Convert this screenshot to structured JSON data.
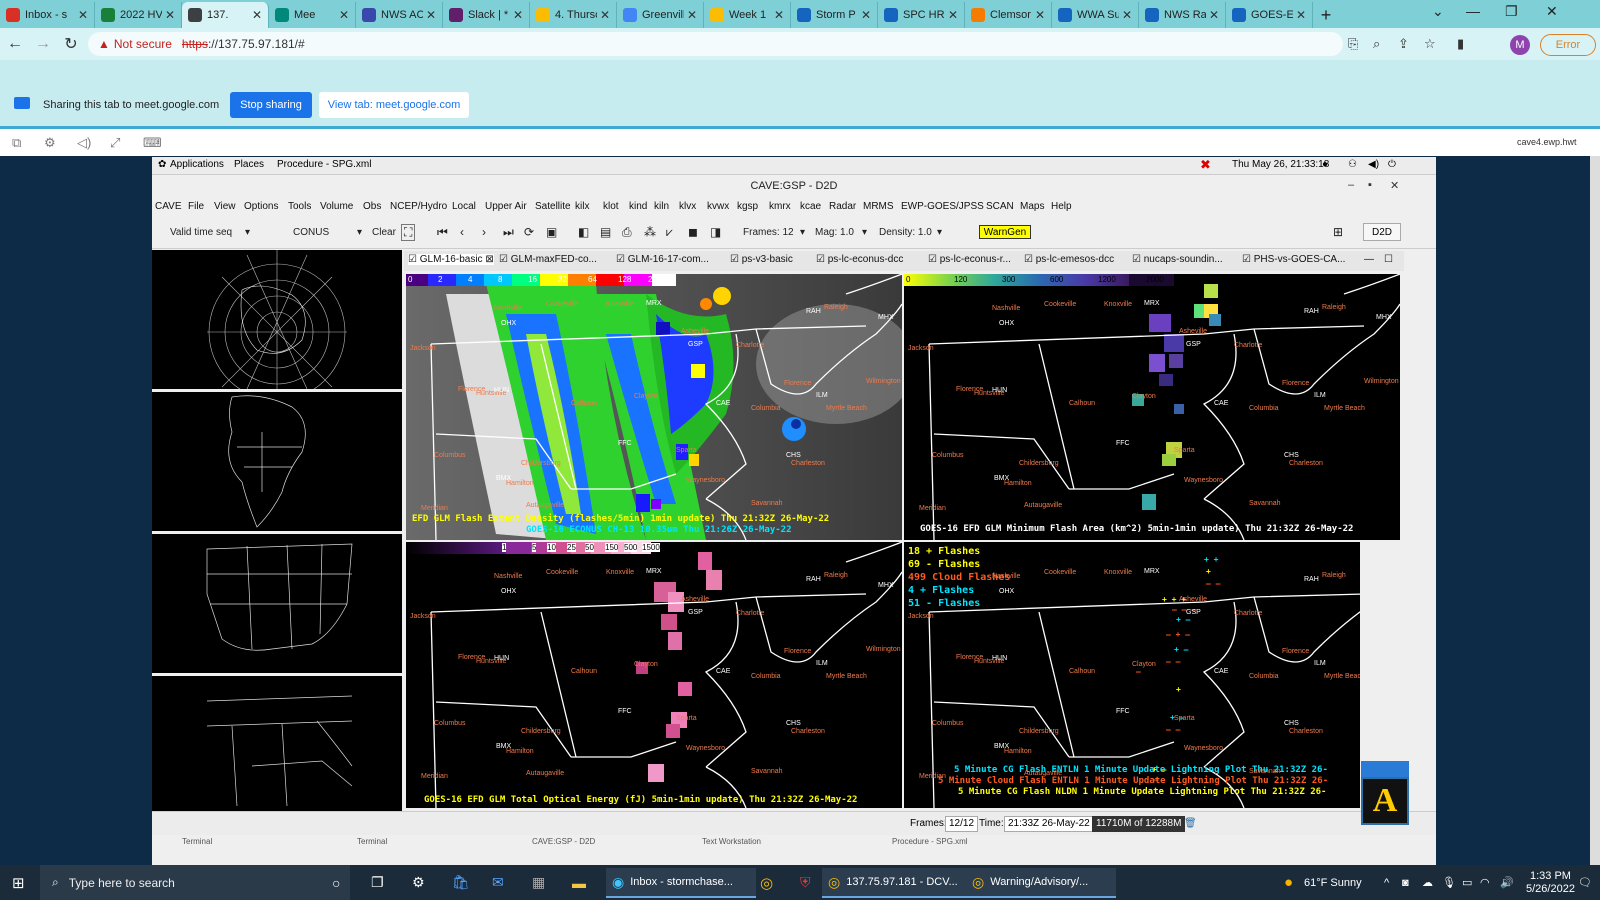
{
  "browser": {
    "tabs": [
      {
        "label": "Inbox - s",
        "color": "#d93025"
      },
      {
        "label": "2022 HV",
        "color": "#188038"
      },
      {
        "label": "137.",
        "color": "#3c4043",
        "active": true
      },
      {
        "label": "Mee",
        "color": "#00897b"
      },
      {
        "label": "NWS AC",
        "color": "#3949ab"
      },
      {
        "label": "Slack | *",
        "color": "#611f69"
      },
      {
        "label": "4. Thursc",
        "color": "#fbbc04"
      },
      {
        "label": "Greenvill",
        "color": "#4285f4"
      },
      {
        "label": "Week 1",
        "color": "#fbbc04"
      },
      {
        "label": "Storm P",
        "color": "#1565c0"
      },
      {
        "label": "SPC HRI",
        "color": "#1565c0"
      },
      {
        "label": "Clemsor",
        "color": "#f57c00"
      },
      {
        "label": "WWA Su",
        "color": "#1565c0"
      },
      {
        "label": "NWS Ra",
        "color": "#1565c0"
      },
      {
        "label": "GOES-E",
        "color": "#1565c0"
      }
    ],
    "new_tab": "+",
    "not_secure": "Not secure",
    "url_scheme": "https",
    "url_rest": "://137.75.97.181/#",
    "profile_initial": "M",
    "error_label": "Error"
  },
  "sharing": {
    "text": "Sharing this tab to meet.google.com",
    "stop_label": "Stop sharing",
    "view_label": "View tab: meet.google.com"
  },
  "remote": {
    "host": "cave4.ewp.hwt"
  },
  "gnome": {
    "applications": "Applications",
    "places": "Places",
    "procedure": "Procedure - SPG.xml",
    "clock": "Thu May 26, 21:33:18"
  },
  "cave": {
    "title": "CAVE:GSP - D2D",
    "menus": [
      "CAVE",
      "File",
      "View",
      "Options",
      "Tools",
      "Volume",
      "Obs",
      "NCEP/Hydro",
      "Local",
      "Upper Air",
      "Satellite",
      "kilx",
      "klot",
      "kind",
      "kiln",
      "klvx",
      "kvwx",
      "kgsp",
      "kmrx",
      "kcae",
      "Radar",
      "MRMS",
      "EWP-GOES/JPSS",
      "SCAN",
      "Maps",
      "Help"
    ],
    "toolbar": {
      "valid_time": "Valid time seq",
      "scale": "CONUS",
      "clear": "Clear",
      "frames": "Frames: 12",
      "mag": "Mag: 1.0",
      "density": "Density: 1.0",
      "warngen": "WarnGen",
      "d2d": "D2D"
    },
    "editor_tabs": [
      "GLM-16-basic",
      "GLM-maxFED-co...",
      "GLM-16-17-com...",
      "ps-v3-basic",
      "ps-lc-econus-dcc",
      "ps-lc-econus-r...",
      "ps-lc-emesos-dcc",
      "nucaps-soundin...",
      "PHS-vs-GOES-CA..."
    ],
    "panels": {
      "p1": {
        "cbar": [
          "0",
          "2",
          "4",
          "8",
          "16",
          "32",
          "64",
          "128",
          "256"
        ],
        "line1": "EFD GLM Flash Extent Density (flashes/5min) 1min update)   Thu 21:32Z 26-May-22",
        "line2": "GOES-16 ECONUS CH-13 10.35um  Thu 21:26Z 26-May-22"
      },
      "p2": {
        "cbar": [
          "0",
          "120",
          "300",
          "600",
          "1200",
          "2000"
        ],
        "line1": "GOES-16 EFD GLM Minimum Flash Area (km^2) 5min-1min update)  Thu 21:32Z 26-May-22"
      },
      "p3": {
        "cbar": [
          "1",
          "5",
          "10",
          "25",
          "50",
          "150",
          "500",
          "1500"
        ],
        "line1": "GOES-16 EFD GLM Total Optical Energy (fJ) 5min-1min update)   Thu 21:32Z 26-May-22"
      },
      "p4": {
        "legend": [
          {
            "text": "18 + Flashes",
            "color": "#ffff00"
          },
          {
            "text": "69 - Flashes",
            "color": "#ffff00"
          },
          {
            "text": "499 Cloud Flashes",
            "color": "#ff5a1f"
          },
          {
            "text": "4 + Flashes",
            "color": "#00e5ff"
          },
          {
            "text": "51 - Flashes",
            "color": "#00e5ff"
          }
        ],
        "bottom": [
          {
            "text": "5 Minute CG Flash ENTLN 1 Minute Update Lightning Plot   Thu 21:32Z 26-",
            "color": "#00e5ff"
          },
          {
            "text": "5 Minute Cloud Flash ENTLN 1 Minute Update Lightning Plot   Thu 21:32Z 26-",
            "color": "#ff5a1f"
          },
          {
            "text": "5 Minute CG Flash NLDN 1 Minute Update Lightning Plot   Thu 21:32Z 26-",
            "color": "#ffff00"
          }
        ]
      }
    },
    "cities": [
      "Nashville",
      "Cookeville",
      "Knoxville",
      "Raleigh",
      "Jackson",
      "Huntsville",
      "Florence",
      "Calhoun",
      "Clayton",
      "Asheville",
      "Charlotte",
      "Columbia",
      "Myrtle Beach",
      "Wilmington",
      "Florence",
      "Columbus",
      "Childersburg",
      "Hamilton",
      "Autaugaville",
      "Meridian",
      "Sparta",
      "Waynesboro",
      "Charleston",
      "Savannah"
    ],
    "stations": [
      "OHX",
      "GSP",
      "RAH",
      "MHX",
      "HUN",
      "FFC",
      "BMX",
      "ILM",
      "CAE",
      "CHS",
      "MRX"
    ],
    "status": {
      "frames_label": "Frames:",
      "frames_val": "12/12",
      "time_label": "Time:",
      "time_val": "21:33Z 26-May-22",
      "memory": "11710M of 12288M"
    },
    "bottom_tasks": [
      "Terminal",
      "Terminal",
      "CAVE:GSP - D2D",
      "Text Workstation",
      "Procedure - SPG.xml"
    ]
  },
  "taskbar": {
    "search_placeholder": "Type here to search",
    "apps": [
      {
        "label": "Inbox - stormchase..."
      },
      {
        "label": "137.75.97.181 - DCV..."
      },
      {
        "label": "Warning/Advisory/..."
      }
    ],
    "weather": "61°F  Sunny",
    "time": "1:33 PM",
    "date": "5/26/2022"
  }
}
